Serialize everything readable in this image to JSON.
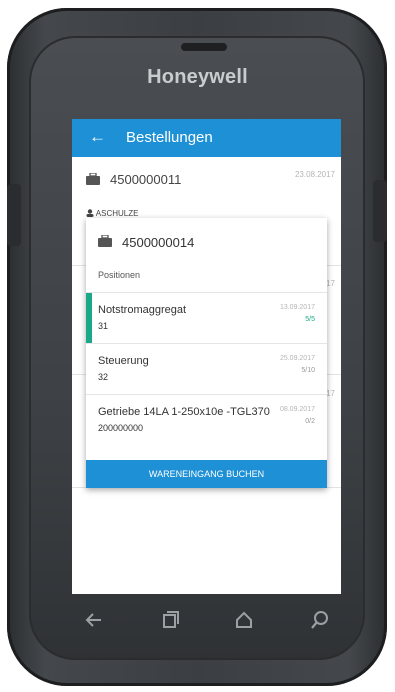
{
  "device": {
    "brand": "Honeywell"
  },
  "appbar": {
    "back_icon": "arrow-left-icon",
    "title": "Bestellungen"
  },
  "background_list": {
    "order_number": "4500000011",
    "order_date": "23.08.2017",
    "user": "ASCHULZE",
    "fragments": [
      "17",
      "17"
    ]
  },
  "detail": {
    "order_number": "4500000014",
    "section_label": "Positionen",
    "positions": [
      {
        "name": "Notstromaggregat",
        "qty": "31",
        "date": "13.09.2017",
        "progress": "5/5",
        "complete": true
      },
      {
        "name": "Steuerung",
        "qty": "32",
        "date": "25.09.2017",
        "progress": "5/10",
        "complete": false
      },
      {
        "name": "Getriebe 14LA 1-250x10e -TGL370",
        "qty": "200000000",
        "date": "08.09.2017",
        "progress": "0/2",
        "complete": false
      }
    ],
    "action_label": "WARENEINGANG BUCHEN"
  },
  "navbar": {
    "icons": [
      "back-icon",
      "recent-apps-icon",
      "home-icon",
      "search-icon"
    ]
  },
  "colors": {
    "accent": "#1e90d6",
    "success": "#1aa888"
  }
}
